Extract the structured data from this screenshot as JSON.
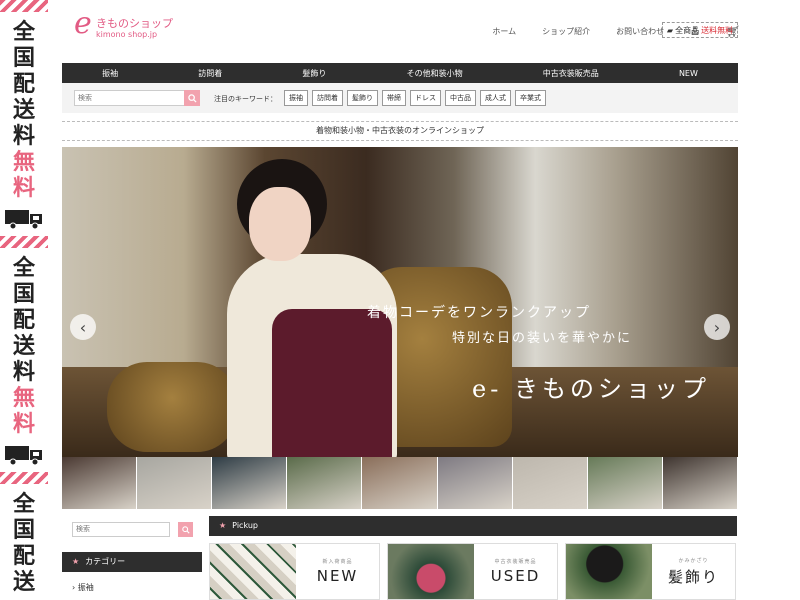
{
  "promo": {
    "chars": [
      "全",
      "国",
      "配",
      "送",
      "料"
    ],
    "pink_chars": [
      "無",
      "料"
    ]
  },
  "header": {
    "logo_mark": "e",
    "logo_text": "きものショップ",
    "logo_sub": "kimono shop.jp",
    "nav": [
      "ホーム",
      "ショップ紹介",
      "お問い合わせ"
    ],
    "free_label_prefix": "全商品",
    "free_label_red": "送料無料"
  },
  "categories": [
    "振袖",
    "訪問着",
    "髪飾り",
    "その他和装小物",
    "中古衣装販売品",
    "NEW"
  ],
  "search": {
    "placeholder": "検索",
    "keywords_label": "注目のキーワード：",
    "keywords": [
      "振袖",
      "訪問着",
      "髪飾り",
      "帯締",
      "ドレス",
      "中古品",
      "成人式",
      "卒業式"
    ]
  },
  "tagline": "着物和装小物・中古衣装のオンラインショップ",
  "hero": {
    "line1": "着物コーデをワンランクアップ",
    "line2": "特別な日の装いを華やかに",
    "line3": "e- きものショップ",
    "thumb_colors": [
      "#4b3a33",
      "#a7a6a0",
      "#2e3c45",
      "#5a6b4a",
      "#8a6e5a",
      "#7e7a82",
      "#bdb7ad",
      "#667a58",
      "#3f3530"
    ]
  },
  "sidebar": {
    "search_placeholder": "検索",
    "category_title": "カテゴリー",
    "items": [
      "振袖"
    ]
  },
  "pickup": {
    "title": "Pickup",
    "cards": [
      {
        "sub": "新入荷商品",
        "label": "NEW"
      },
      {
        "sub": "中古衣装販売品",
        "label": "USED"
      },
      {
        "sub": "かみかざり",
        "label": "髪飾り"
      }
    ]
  }
}
